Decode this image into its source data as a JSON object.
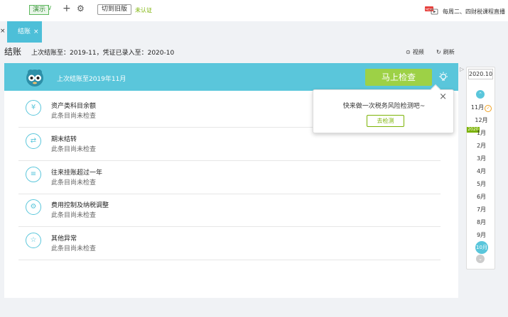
{
  "topbar": {
    "account": "演示",
    "add_icon": "plus-icon",
    "settings_icon": "gear-icon",
    "old_version_button": "切到旧版",
    "unverified": "未认证",
    "live_badge": "NEW",
    "live_text": "每周二、四财税课程直播"
  },
  "tabs": [
    {
      "label": "结账"
    }
  ],
  "tab_close": "×",
  "page": {
    "title": "结账",
    "subtitle": "上次结账至：2019-11，凭证已录入至：2020-10",
    "video_label": "视频",
    "refresh_label": "刷新"
  },
  "banner": {
    "text": "上次结账至2019年11月",
    "check_button": "马上检查"
  },
  "items": [
    {
      "icon": "yen-icon",
      "icon_glyph": "¥",
      "title": "资产类科目余额",
      "status": "此条目尚未检查"
    },
    {
      "icon": "transfer-icon",
      "icon_glyph": "⇄",
      "title": "期末结转",
      "status": "此条目尚未检查"
    },
    {
      "icon": "document-icon",
      "icon_glyph": "≡",
      "title": "往来挂账超过一年",
      "status": "此条目尚未检查"
    },
    {
      "icon": "tax-adjust-icon",
      "icon_glyph": "⚙",
      "title": "费用控制及纳税调整",
      "status": "此条目尚未检查"
    },
    {
      "icon": "star-icon",
      "icon_glyph": "☆",
      "title": "其他异常",
      "status": "此条目尚未检查"
    }
  ],
  "popover": {
    "text": "快来做一次税务风险检测吧~",
    "button": "去检测",
    "close": "×"
  },
  "timeline": {
    "year_selected": "2020.10",
    "year_marker": "2020",
    "months": [
      "11月",
      "12月",
      "1月",
      "2月",
      "3月",
      "4月",
      "5月",
      "6月",
      "7月",
      "8月",
      "9月",
      "10月"
    ],
    "active_month": "10月"
  },
  "colors": {
    "accent": "#5ac6db",
    "check_button": "#9dd146",
    "green": "#7cb305"
  }
}
